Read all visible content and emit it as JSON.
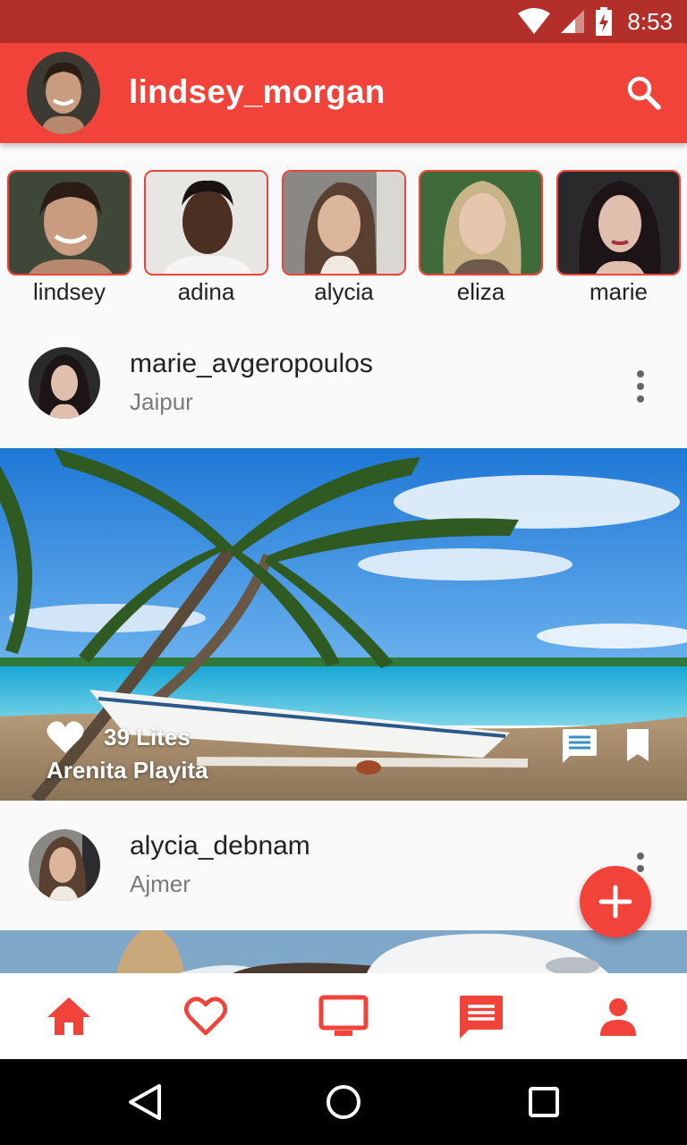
{
  "status_bar": {
    "time": "8:53"
  },
  "app_bar": {
    "title": "lindsey_morgan"
  },
  "stories": [
    {
      "label": "lindsey"
    },
    {
      "label": "adina"
    },
    {
      "label": "alycia"
    },
    {
      "label": "eliza"
    },
    {
      "label": "marie"
    }
  ],
  "posts": [
    {
      "username": "marie_avgeropoulos",
      "location": "Jaipur",
      "likes": "39 Lites",
      "place": "Arenita Playita"
    },
    {
      "username": "alycia_debnam",
      "location": "Ajmer"
    }
  ],
  "colors": {
    "accent": "#f2433a",
    "status_bar": "#b3302a"
  },
  "bottom_nav": [
    {
      "icon": "home-icon"
    },
    {
      "icon": "heart-icon"
    },
    {
      "icon": "tv-icon"
    },
    {
      "icon": "chat-icon"
    },
    {
      "icon": "person-icon"
    }
  ]
}
